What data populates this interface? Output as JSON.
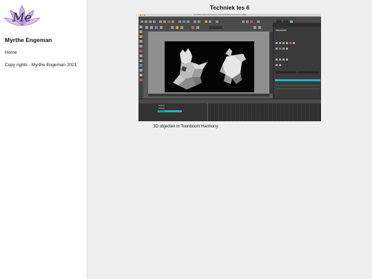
{
  "sidebar": {
    "logo_text": "Me",
    "site_name": "Myrthe Engeman",
    "nav": [
      {
        "label": "Home"
      }
    ],
    "copyright": "Copy rights - Myrthe Engeman 2021"
  },
  "main": {
    "title": "Techniek les 6",
    "caption": "3D objecten in Toonboom Harmony.",
    "screenshot": {
      "app": "Toon Boom Harmony",
      "window_title": "Toon Boom Harmony Premium: Setup and Harmony Premium.xstage",
      "layers": [
        "Drawing",
        "Drawing",
        "Drawing"
      ]
    }
  },
  "colors": {
    "logo": "#b58bd6",
    "accent": "#1fb7c4",
    "playhead": "#d93333"
  }
}
